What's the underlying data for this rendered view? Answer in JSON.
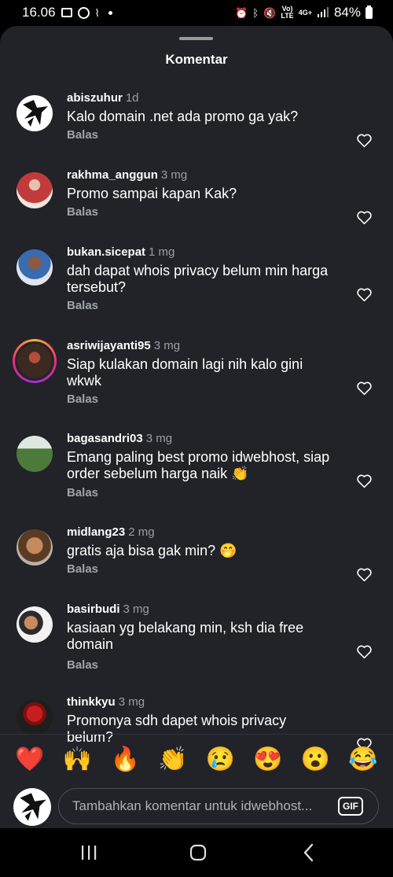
{
  "status_bar": {
    "time": "16.06",
    "net_top": "Vo)",
    "net_bottom": "LTE",
    "gen_top": "4G+",
    "battery": "84%"
  },
  "sheet": {
    "title": "Komentar"
  },
  "comments": [
    {
      "user": "abiszuhur",
      "time": "1d",
      "text": "Kalo domain .net ada promo ga yak?",
      "reply": "Balas"
    },
    {
      "user": "rakhma_anggun",
      "time": "3 mg",
      "text": "Promo sampai kapan Kak?",
      "reply": "Balas"
    },
    {
      "user": "bukan.sicepat",
      "time": "1 mg",
      "text": "dah dapat whois privacy belum min harga tersebut?",
      "reply": "Balas"
    },
    {
      "user": "asriwijayanti95",
      "time": "3 mg",
      "text": "Siap kulakan domain lagi nih kalo gini wkwk",
      "reply": "Balas"
    },
    {
      "user": "bagasandri03",
      "time": "3 mg",
      "text": "Emang paling best promo  idwebhost, siap order sebelum harga naik 👏",
      "reply": "Balas"
    },
    {
      "user": "midlang23",
      "time": "2 mg",
      "text": "gratis aja bisa gak min? 🤭",
      "reply": "Balas"
    },
    {
      "user": "basirbudi",
      "time": "3 mg",
      "text": "kasiaan yg belakang min, ksh dia free domain",
      "reply": "Balas"
    },
    {
      "user": "thinkkyu",
      "time": "3 mg",
      "text": "Promonya sdh dapet whois privacy belum?",
      "reply": ""
    }
  ],
  "emoji_bar": [
    "❤️",
    "🙌",
    "🔥",
    "👏",
    "😢",
    "😍",
    "😮",
    "😂"
  ],
  "composer": {
    "placeholder": "Tambahkan komentar untuk idwebhost...",
    "gif_label": "GIF"
  },
  "icons": {
    "heart": "heart-outline-icon",
    "nav_recents": "recents-icon",
    "nav_home": "home-icon",
    "nav_back": "back-icon"
  },
  "colors": {
    "background": "#212328",
    "secondary_text": "#9a9ea6",
    "divider": "#30333a"
  }
}
